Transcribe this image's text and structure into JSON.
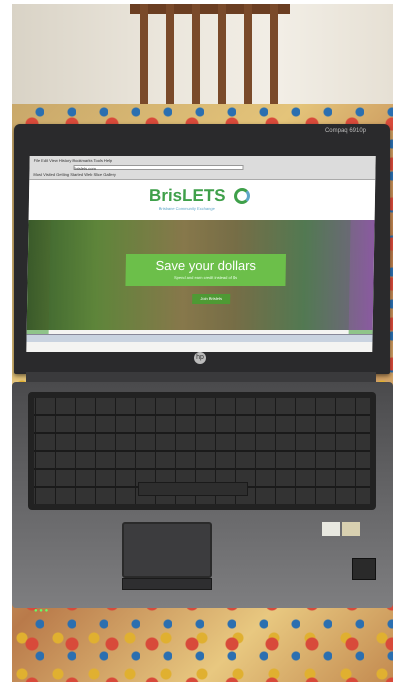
{
  "scene": "photo",
  "laptop": {
    "corner_brand": "Compaq 6910p",
    "hp_logo": "hp",
    "stickers": [
      "",
      ""
    ]
  },
  "browser": {
    "menu": "File  Edit  View  History  Bookmarks  Tools  Help",
    "bookmarks": "Most Visited  Getting Started  Web Slice Gallery",
    "address": "brislets.com"
  },
  "website": {
    "title": "BrisLETS",
    "subtitle": "Brisbane Community Exchange",
    "hero_title": "Save your dollars",
    "hero_subtitle": "Spend and earn credit instead of $s",
    "hero_button": "Join Brislets"
  },
  "colors": {
    "brand_green": "#3fa04a",
    "brand_blue": "#5fa6c8"
  }
}
